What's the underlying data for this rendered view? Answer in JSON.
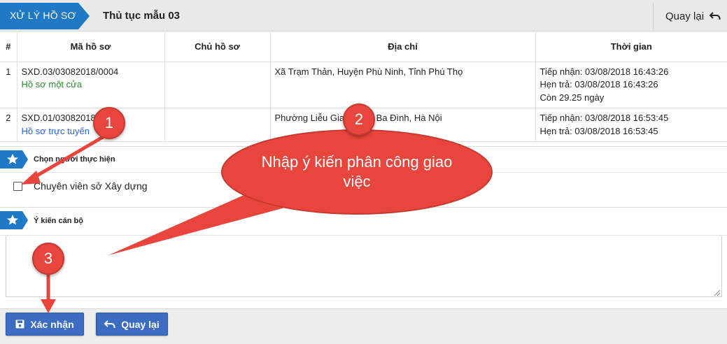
{
  "header": {
    "breadcrumb": "XỬ LÝ HỒ SƠ",
    "procedure_title": "Thủ tục mẫu 03",
    "back_label": "Quay lại"
  },
  "table": {
    "columns": [
      "#",
      "Mã hồ sơ",
      "Chủ hồ sơ",
      "Địa chỉ",
      "Thời gian"
    ],
    "rows": [
      {
        "num": "1",
        "code": "SXD.03/03082018/0004",
        "channel": "Hồ sơ một cửa",
        "owner": "",
        "address": "Xã Trạm Thản, Huyện Phù Ninh, Tỉnh Phú Thọ",
        "received": "Tiếp nhận: 03/08/2018 16:43:26",
        "due": "Hẹn trả: 03/08/2018 16:43:26",
        "remaining": "Còn 29.25 ngày"
      },
      {
        "num": "2",
        "code": "SXD.01/03082018/0002",
        "channel": "Hồ sơ trực tuyến",
        "owner": "",
        "address": "Phường Liễu Giai, Quận Ba Đình, Hà Nội",
        "received": "Tiếp nhận: 03/08/2018 16:53:45",
        "due": "Hẹn trả: 03/08/2018 16:53:45"
      }
    ]
  },
  "assign_section": {
    "title": "Chọn người thực hiện",
    "option_label": "Chuyên viên sở Xây dựng",
    "checked": false
  },
  "opinion_section": {
    "title": "Ý kiến cán bộ",
    "value": ""
  },
  "footer": {
    "confirm_label": "Xác nhận",
    "back_label": "Quay lại"
  },
  "annotations": {
    "callout_text": "Nhập ý kiến phân công giao việc",
    "badges": [
      "1",
      "2",
      "3"
    ]
  },
  "colors": {
    "primary": "#3b6cc2",
    "breadcrumb": "#1f79c4",
    "annotation_red": "#e8453c",
    "green_link": "#2a8a2a",
    "blue_link": "#2a5fd8"
  }
}
